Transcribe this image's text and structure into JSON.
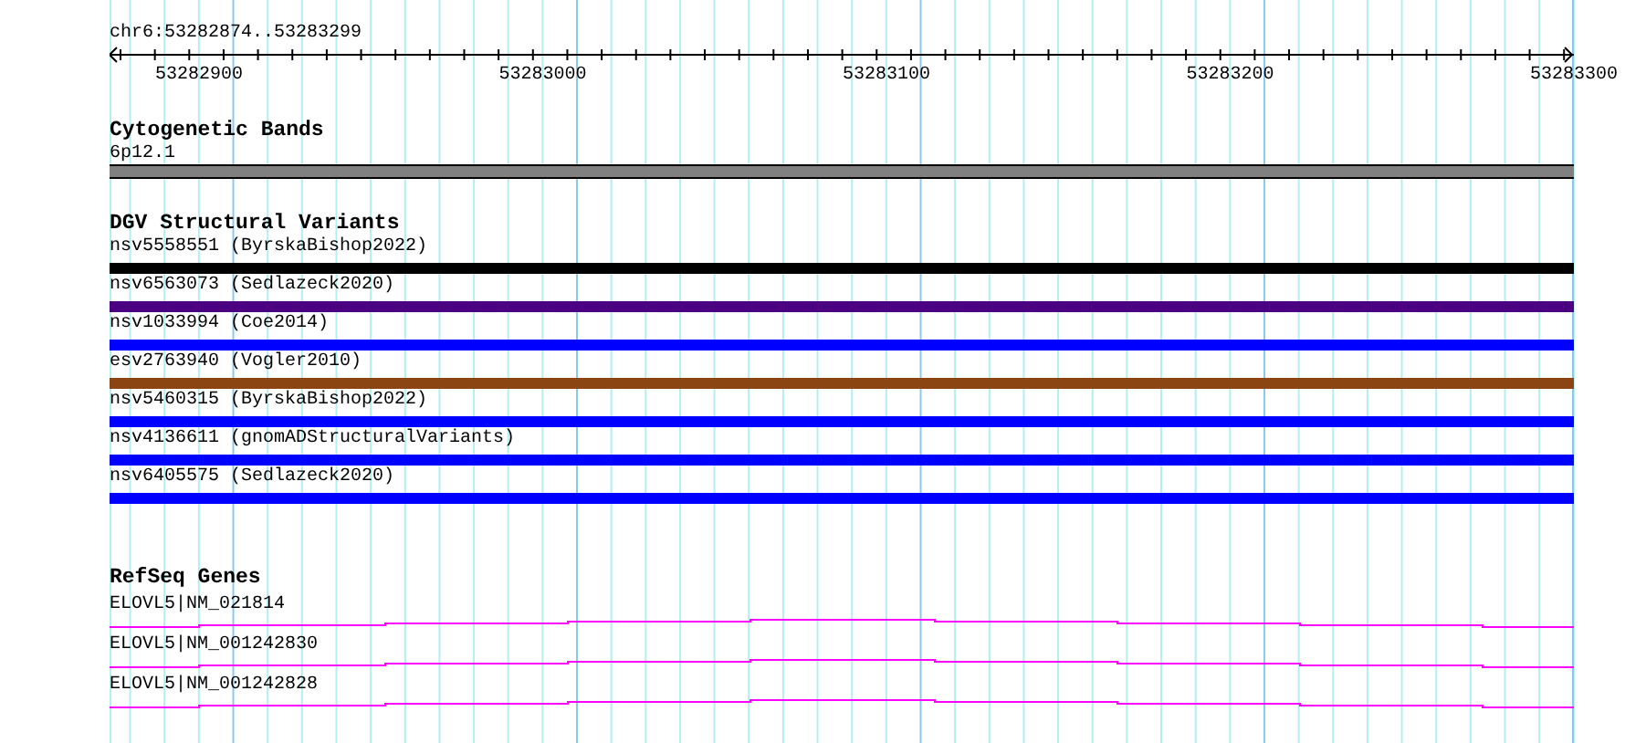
{
  "ruler": {
    "location": "chr6:53282874..53283299",
    "ticks": [
      "53282900",
      "53283000",
      "53283100",
      "53283200",
      "53283300"
    ]
  },
  "tracks": [
    {
      "title": "Cytogenetic Bands",
      "features": [
        {
          "kind": "band",
          "label": "6p12.1",
          "color": "#808080"
        }
      ]
    },
    {
      "title": "DGV Structural Variants",
      "features": [
        {
          "kind": "variant",
          "label": "nsv5558551 (ByrskaBishop2022)",
          "color": "#000000"
        },
        {
          "kind": "variant",
          "label": "nsv6563073 (Sedlazeck2020)",
          "color": "#4b0082"
        },
        {
          "kind": "variant",
          "label": "nsv1033994 (Coe2014)",
          "color": "#0000ff"
        },
        {
          "kind": "variant",
          "label": "esv2763940 (Vogler2010)",
          "color": "#8b4513"
        },
        {
          "kind": "variant",
          "label": "nsv5460315 (ByrskaBishop2022)",
          "color": "#0000ff"
        },
        {
          "kind": "variant",
          "label": "nsv4136611 (gnomADStructuralVariants)",
          "color": "#0000ff"
        },
        {
          "kind": "variant",
          "label": "nsv6405575 (Sedlazeck2020)",
          "color": "#0000ff"
        }
      ]
    },
    {
      "title": "RefSeq Genes",
      "features": [
        {
          "kind": "gene",
          "label": "ELOVL5|NM_021814"
        },
        {
          "kind": "gene",
          "label": "ELOVL5|NM_001242830"
        },
        {
          "kind": "gene",
          "label": "ELOVL5|NM_001242828"
        }
      ]
    }
  ]
}
